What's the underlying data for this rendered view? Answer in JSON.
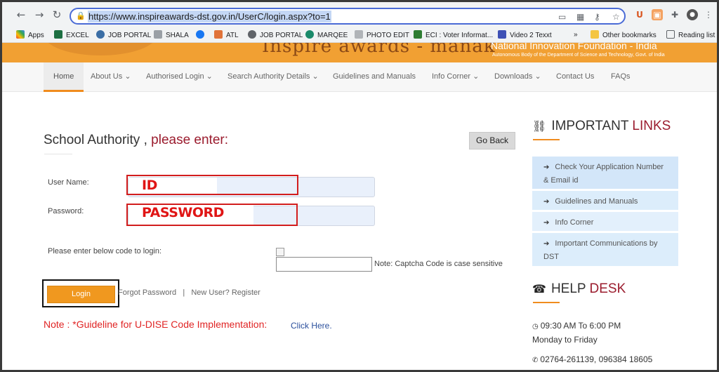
{
  "browser": {
    "url": "https://www.inspireawards-dst.gov.in/UserC/login.aspx?to=1",
    "bookmarks": [
      "Apps",
      "EXCEL",
      "JOB PORTAL",
      "SHALA",
      "ATL",
      "JOB PORTAL",
      "MARQEE",
      "PHOTO EDIT",
      "ECI : Voter Informat...",
      "Video 2 Texxt",
      "»",
      "Other bookmarks",
      "Reading list"
    ]
  },
  "banner": {
    "title": "Inspire awards - manak",
    "org": "National Innovation Foundation - India",
    "sub": "Autonomous Body of the Department of Science and Technology, Govt. of India"
  },
  "nav": {
    "items": [
      "Home",
      "About Us",
      "Authorised Login",
      "Search Authority Details",
      "Guidelines and Manuals",
      "Info Corner",
      "Downloads",
      "Contact Us",
      "FAQs"
    ]
  },
  "login": {
    "heading_main": "School Authority ,",
    "heading_accent": "please enter:",
    "go_back": "Go Back",
    "username_label": "User Name:",
    "password_label": "Password:",
    "username_annotation": "ID",
    "password_annotation": "PASSWORD",
    "captcha_label": "Please enter below code to login:",
    "captcha_note": "Note: Captcha Code is case sensitive",
    "login_button": "Login",
    "forgot_password": "Forgot Password",
    "separator": "|",
    "new_user": "New User? Register",
    "udise_note": "Note : *Guideline for U-DISE Code Implementation:",
    "click_here": "Click Here."
  },
  "important_links": {
    "title_main": "IMPORTANT",
    "title_accent": "LINKS",
    "items": [
      "Check Your Application Number & Email id",
      "Guidelines and Manuals",
      "Info Corner",
      "Important Communications by DST"
    ]
  },
  "help_desk": {
    "title_main": "HELP",
    "title_accent": "DESK",
    "hours": "09:30 AM To 6:00 PM",
    "days": "Monday to Friday",
    "phone": "02764-261139, 096384 18605"
  },
  "colors": {
    "accent_orange": "#f0981f",
    "accent_maroon": "#9b1c2e",
    "annotation_red": "#d21d1d",
    "link_blue_bg": "#d3e6f9"
  }
}
